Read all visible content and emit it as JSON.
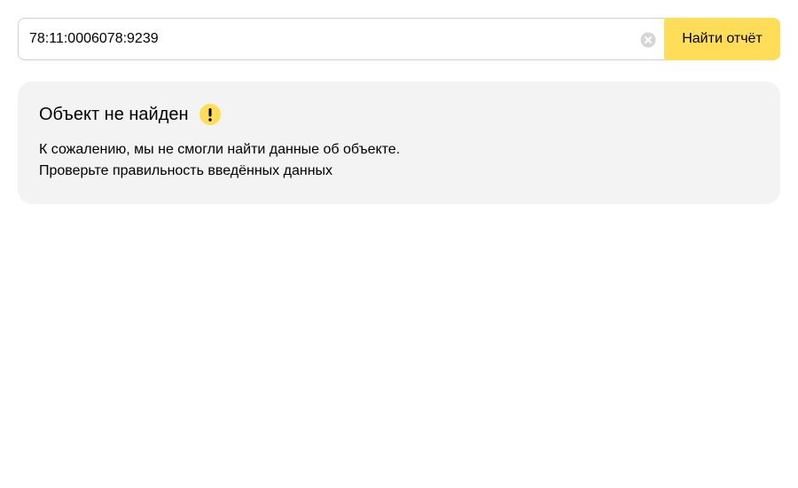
{
  "search": {
    "value": "78:11:0006078:9239",
    "clear_icon": "clear-circle-icon",
    "submit_label": "Найти отчёт",
    "accent_color": "#ffdd59"
  },
  "result": {
    "title": "Объект не найден",
    "status_icon": "exclamation-icon",
    "status_color": "#ffdd59",
    "message_line1": "К сожалению, мы не смогли найти данные об объекте.",
    "message_line2": "Проверьте правильность введённых данных"
  }
}
